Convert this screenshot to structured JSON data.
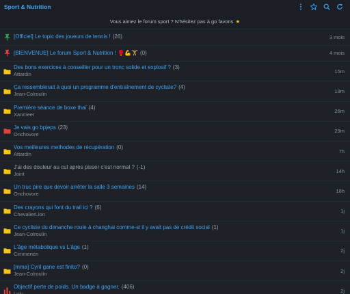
{
  "header": {
    "title": "Sport & Nutrition",
    "icons": [
      "more-vertical-icon",
      "star-icon",
      "search-icon",
      "refresh-icon"
    ]
  },
  "banner": {
    "text": "Vous aimez le forum sport ? N'hésitez pas à go favoris"
  },
  "colors": {
    "accent": "#3da4f4",
    "folder": "#f5c518",
    "hot": "#e0433d",
    "pin_green": "#2ea44f",
    "pin_red": "#e0433d",
    "background": "#1b1e24"
  },
  "topics": [
    {
      "icon": "pin-green-icon",
      "title": "[Officiel] Le topic des joueurs de tennis !",
      "count": "(26)",
      "author": "",
      "time": "3 mois",
      "read": false
    },
    {
      "icon": "pin-red-icon",
      "title": "[BIENVENUE] Le forum Sport & Nutrition ! 🥊💪🏋",
      "count": "(0)",
      "author": "",
      "time": "4 mois",
      "read": false
    },
    {
      "icon": "folder-icon",
      "title": "Des bons exercices à conseiller pour un tronc solide et explosif ?",
      "count": "(3)",
      "author": "Attardin",
      "time": "15m",
      "read": false
    },
    {
      "icon": "folder-icon",
      "title": "Ça ressemblerait à quoi un programme d'entraînement de cycliste?",
      "count": "(4)",
      "author": "Jean-Colroulin",
      "time": "19m",
      "read": false
    },
    {
      "icon": "folder-icon",
      "title": "Première séance de boxe thaï",
      "count": "(4)",
      "author": "Xanmeer",
      "time": "26m",
      "read": false
    },
    {
      "icon": "folder-red-icon",
      "title": "Je vais go bpjeps",
      "count": "(23)",
      "author": "Onchovore",
      "time": "29m",
      "read": false
    },
    {
      "icon": "folder-icon",
      "title": "Vos meilleures methodes de récupération",
      "count": "(0)",
      "author": "Attardin",
      "time": "7h",
      "read": false
    },
    {
      "icon": "folder-icon",
      "title": "J'ai des douleur au cul après pisser c'est normal ?",
      "count": "(-1)",
      "author": "Joint",
      "time": "14h",
      "read": true
    },
    {
      "icon": "folder-icon",
      "title": "Un truc pire que devoir arrêter la salle 3 semaines",
      "count": "(14)",
      "author": "Onchovore",
      "time": "16h",
      "read": false
    },
    {
      "icon": "folder-icon",
      "title": "Des crayons qui font du trail ici ?",
      "count": "(6)",
      "author": "ChevalierLion",
      "time": "1j",
      "read": false
    },
    {
      "icon": "folder-icon",
      "title": "Ce cycliste du dimanche roule à changhai comme-si il y avait pas de crédit social",
      "count": "(1)",
      "author": "Jean-Colroulin",
      "time": "1j",
      "read": false
    },
    {
      "icon": "folder-icon",
      "title": "L'âge métabolique vs L'âge",
      "count": "(1)",
      "author": "Cimmerien",
      "time": "2j",
      "read": false
    },
    {
      "icon": "folder-icon",
      "title": "[mma] Cyril gane est finito?",
      "count": "(0)",
      "author": "Jean-Colroulin",
      "time": "2j",
      "read": false
    },
    {
      "icon": "poll-icon",
      "title": "Objectif perte de poids. Un badge à gagner.",
      "count": "(406)",
      "author": "Lulu",
      "time": "2j",
      "read": false
    }
  ]
}
